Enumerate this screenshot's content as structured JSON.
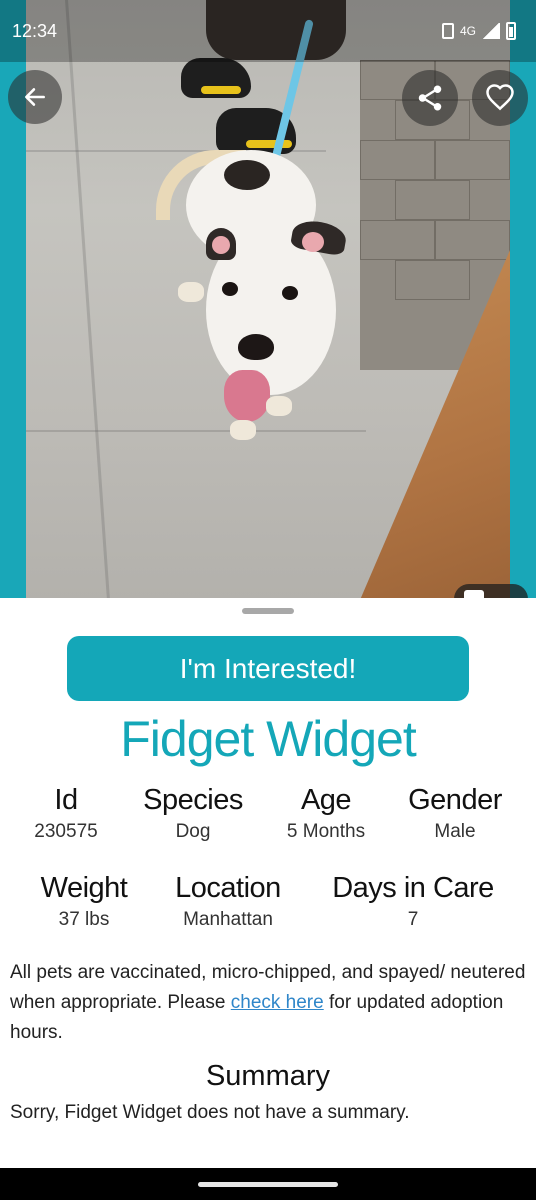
{
  "status_bar": {
    "time": "12:34",
    "network": "4G"
  },
  "photo": {
    "description_icon": "dog-photo",
    "back_icon": "arrow-left-icon",
    "share_icon": "share-icon",
    "favorite_icon": "heart-outline-icon",
    "gallery_icon": "camera-icon"
  },
  "sheet": {
    "cta_label": "I'm Interested!",
    "pet_name": "Fidget Widget",
    "stats_row1": [
      {
        "label": "Id",
        "value": "230575"
      },
      {
        "label": "Species",
        "value": "Dog"
      },
      {
        "label": "Age",
        "value": "5 Months"
      },
      {
        "label": "Gender",
        "value": "Male"
      }
    ],
    "stats_row2": [
      {
        "label": "Weight",
        "value": "37 lbs"
      },
      {
        "label": "Location",
        "value": "Manhattan"
      },
      {
        "label": "Days in Care",
        "value": "7"
      }
    ],
    "note_before": "All pets are vaccinated, micro-chipped, and spayed/ neutered when appropriate. Please ",
    "note_link": "check here",
    "note_after": " for updated adoption hours.",
    "summary_title": "Summary",
    "summary_text": "Sorry, Fidget Widget does not have a summary."
  },
  "colors": {
    "accent": "#14a7b8",
    "link": "#2f86c9"
  }
}
